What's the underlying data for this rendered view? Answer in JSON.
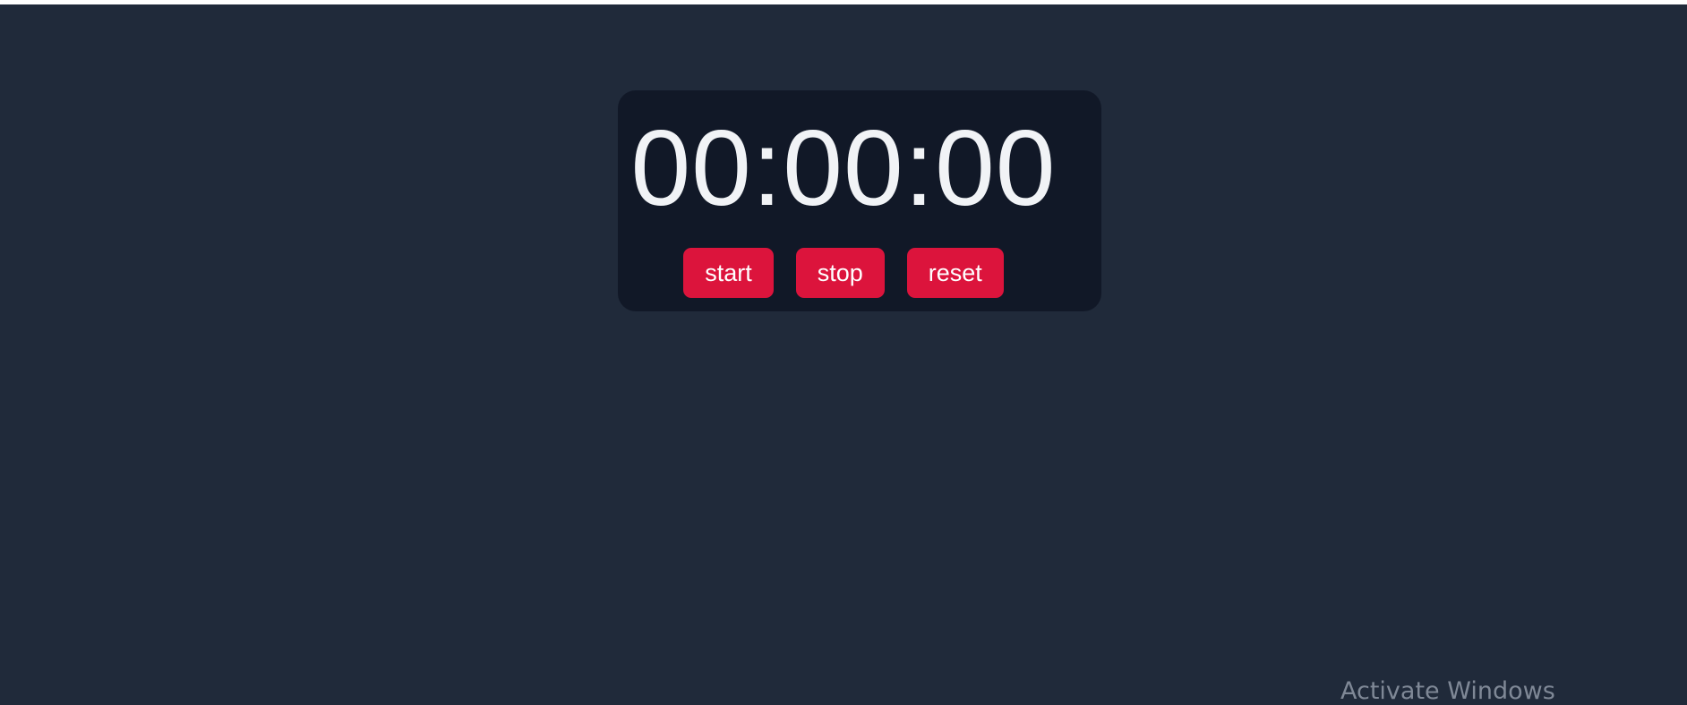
{
  "stopwatch": {
    "display": "00:00:00",
    "buttons": {
      "start": "start",
      "stop": "stop",
      "reset": "reset"
    }
  },
  "watermark": {
    "text": "Activate Windows"
  },
  "colors": {
    "background": "#202a3a",
    "panel": "#111827",
    "button": "#dc143c",
    "display_text": "#f1f3f6"
  }
}
